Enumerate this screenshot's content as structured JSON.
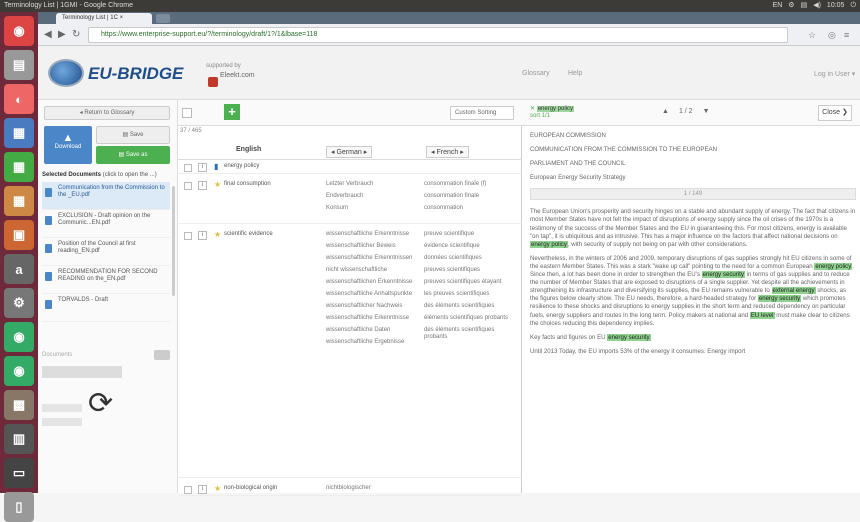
{
  "os": {
    "window_title": "Terminology List | 1GMI - Google Chrome",
    "tray": [
      "EN",
      "⚙",
      "▤",
      "◀)",
      "10:05",
      "⏻"
    ]
  },
  "launcher": [
    {
      "icon": "dash-icon",
      "g": "◉",
      "c": "#d44"
    },
    {
      "icon": "files-icon",
      "g": "▤",
      "c": "#999"
    },
    {
      "icon": "firefox-icon",
      "g": "◐",
      "c": "#e66"
    },
    {
      "icon": "writer-icon",
      "g": "▦",
      "c": "#4a7ac0"
    },
    {
      "icon": "calc-icon",
      "g": "▦",
      "c": "#4a4"
    },
    {
      "icon": "impress-icon",
      "g": "▦",
      "c": "#c84"
    },
    {
      "icon": "software-center-icon",
      "g": "▣",
      "c": "#c63"
    },
    {
      "icon": "amazon-icon",
      "g": "a",
      "c": "#666"
    },
    {
      "icon": "settings-icon",
      "g": "⚙",
      "c": "#777"
    },
    {
      "icon": "chrome-icon",
      "g": "◉",
      "c": "#3a6"
    },
    {
      "icon": "chrome-alt-icon",
      "g": "◉",
      "c": "#3a6"
    },
    {
      "icon": "image-viewer-icon",
      "g": "▩",
      "c": "#876"
    },
    {
      "icon": "workspace-icon",
      "g": "▥",
      "c": "#555"
    },
    {
      "icon": "terminal-icon",
      "g": "▭",
      "c": "#444"
    },
    {
      "icon": "trash-icon",
      "g": "▯",
      "c": "#999"
    }
  ],
  "browser": {
    "tab_title": "Terminology List | 1C ×",
    "url": "https://www.enterprise-support.eu/?/terminology/draft/1?/1&lbase=118"
  },
  "header": {
    "logo": "EU-BRIDGE",
    "supported_by": "supported by",
    "supported_name": "Eleekt.com",
    "glossary": "Glossary",
    "help": "Help",
    "user": "Log in User ▾"
  },
  "left": {
    "back": "◂ Return to Glossary",
    "download": "Download",
    "save": "Save",
    "save_as": "Save as",
    "selected_label": "Selected Documents",
    "selected_hint": "(click to open the ...)",
    "search_placeholder": "Documents",
    "documents": [
      {
        "label": "Communication from the Commission to the _EU.pdf"
      },
      {
        "label": "EXCLUSION - Draft opinion on the Communic...EN.pdf"
      },
      {
        "label": "Position of the Council at first reading_EN.pdf"
      },
      {
        "label": "RECOMMENDATION FOR SECOND READING on the_EN.pdf"
      },
      {
        "label": "TORVALDS - Draft"
      }
    ]
  },
  "terms": {
    "sort": "Custom Sorting",
    "count": "37 / 465",
    "col_en": "English",
    "col_de": "German",
    "col_fr": "French",
    "rows": [
      {
        "en": "energy policy",
        "de": [],
        "fr": [],
        "h": 14
      },
      {
        "en": "final consumption",
        "de": [
          "Letzter Verbrauch",
          "Endverbrauch",
          "Konsum"
        ],
        "fr": [
          "consommation finale (f)",
          "consommation finale",
          "consommation"
        ],
        "h": 46
      },
      {
        "en": "scientific evidence",
        "de": [
          "wissenschaftliche Erkenntnisse",
          "wissenschaftlicher Beweis",
          "wissenschaftliche Erkenntnissen",
          "nicht wissenschaftliche",
          "wissenschaftlichen Erkenntnisse",
          "wissenschaftliche Anhaltspunkte",
          "wissenschaftlicher Nachweis",
          "wissenschaftliche Erkenntnisse",
          "wissenschaftliche Daten",
          "wissenschaftliche Ergebnisse"
        ],
        "fr": [
          "preuve scientifique",
          "évidence scientifique",
          "données scientifiques",
          "preuves scientifiques",
          "preuves scientifiques étayant",
          "les preuves scientifiques",
          "des éléments scientifiques",
          "éléments scientifiques probants",
          "des éléments scientifiques probants"
        ],
        "h": 250
      },
      {
        "en": "non-biological origin",
        "de": [
          "nichtbiologischer"
        ],
        "fr": [],
        "h": 14
      }
    ]
  },
  "right": {
    "filter": "energy policy",
    "filter2": "sort 1/1",
    "nav_pos": "1 / 2",
    "close": "Close",
    "heading1": "EUROPEAN COMMISSION",
    "heading2": "COMMUNICATION FROM THE COMMISSION TO THE EUROPEAN",
    "heading3": "PARLIAMENT AND THE COUNCIL",
    "heading4": "European Energy Security Strategy",
    "sep": "1 / 149",
    "p1_a": "The European Union's prosperity and security hinges on a stable and abundant supply of energy. The fact that citizens in most Member States have not felt the impact of disruptions of energy supply since the oil crises of the 1970s is a testimony of the success of the Member States and the EU in guaranteeing this. For most citizens, energy is available \"on tap\", it is ubiquitous and as intrusive. This has a major influence on the factors that affect national decisions on",
    "p1_hl": "energy policy",
    "p1_b": ", with security of supply not being on par with other considerations.",
    "p2_a": "Nevertheless, in the winters of 2006 and 2009, temporary disruptions of gas supplies strongly hit EU citizens in some of the eastern Member States. This was a stark \"wake up call\" pointing to the need for a common European",
    "p2_hl1": "energy policy",
    "p2_b": ". Since then, a lot has been done in order to strengthen the EU's",
    "p2_hl2": "energy security",
    "p2_c": "in terms of gas supplies and to reduce the number of Member States that are exposed to disruptions of a single supplier. Yet despite all the achievements in strengthening its infrastructure and diversifying its supplies, the EU remains vulnerable to",
    "p2_hl3": "external energy",
    "p2_d": "shocks, as the figures below clearly show. The EU needs, therefore, a hard-headed strategy for",
    "p2_hl4": "energy security",
    "p2_e": "which promotes resilience to these shocks and disruptions to energy supplies in the short term and reduced dependency on particular fuels, energy suppliers and routes in the long term. Policy makers at national and",
    "p2_hl5": "EU level",
    "p2_f": "must make clear to citizens the choices reducing this dependency implies.",
    "p3_a": "Key facts and figures on EU",
    "p3_hl": "energy security",
    "p4": "Until 2013 Today, the EU imports 53% of the energy it consumes. Energy import"
  }
}
